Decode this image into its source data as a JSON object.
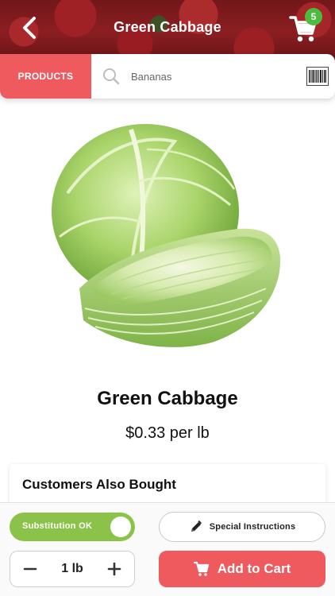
{
  "header": {
    "title": "Green Cabbage",
    "back_icon": "chevron-left-icon",
    "cart_icon": "shopping-cart-icon",
    "cart_count": "5"
  },
  "search": {
    "tab_label": "PRODUCTS",
    "placeholder": "Bananas",
    "search_icon": "search-icon",
    "barcode_icon": "barcode-icon"
  },
  "product": {
    "name": "Green Cabbage",
    "price": "$0.33 per lb"
  },
  "also_bought": {
    "title": "Customers Also Bought"
  },
  "actions": {
    "substitution_label": "Substitution OK",
    "substitution_on": true,
    "special_instructions_label": "Special Instructions",
    "quantity": "1 lb",
    "add_to_cart_label": "Add to Cart"
  },
  "colors": {
    "accent": "#ee5a5e",
    "toggle_on": "#8bc34a",
    "badge": "#4cbb3f"
  }
}
